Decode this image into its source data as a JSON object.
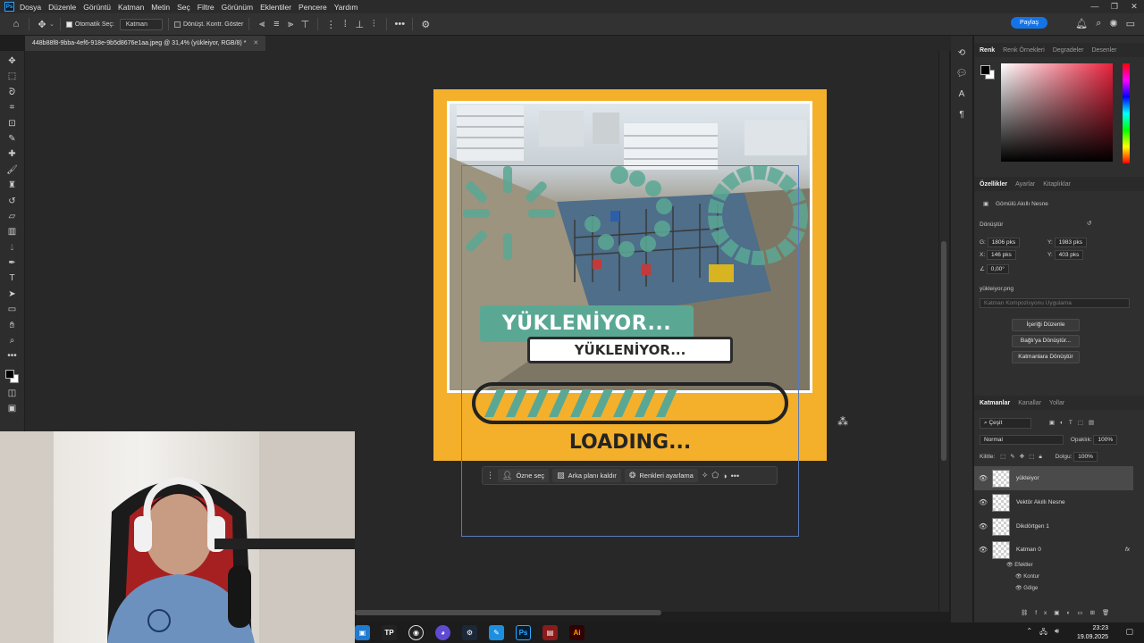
{
  "menu": {
    "logo": "Ps",
    "items": [
      "Dosya",
      "Düzenle",
      "Görüntü",
      "Katman",
      "Metin",
      "Seç",
      "Filtre",
      "Görünüm",
      "Eklentiler",
      "Pencere",
      "Yardım"
    ]
  },
  "options_bar": {
    "auto_select_label": "Otomatik Seç:",
    "auto_select_value": "Katman",
    "transform_controls_label": "Dönüşt. Kontr. Göster",
    "share_label": "Paylaş"
  },
  "document": {
    "tab_title": "448b88f8-9bba-4ef6-918e-9b5d8676e1aa.jpeg @ 31,4% (yükleiyor, RGB/8) *"
  },
  "artwork": {
    "pill_text": "YÜKLENİYOR...",
    "box_text": "YÜKLENİYOR...",
    "loading_text": "LOADING...",
    "accent_color": "#f4b02b",
    "teal_color": "#5aa894"
  },
  "context_bar": {
    "select_subject": "Özne seç",
    "remove_background": "Arka planı kaldır",
    "color_adjust": "Renkleri ayarlama"
  },
  "color_panel": {
    "tabs": [
      "Renk",
      "Renk Örnekleri",
      "Degradeler",
      "Desenler"
    ]
  },
  "properties_panel": {
    "tabs": [
      "Özellikler",
      "Ayarlar",
      "Kitaplıklar"
    ],
    "object_type": "Gömülü Akıllı Nesne",
    "section_transform": "Dönüştür",
    "w_label": "G:",
    "w_value": "1806 pks",
    "h_label": "Y:",
    "h_value": "1983 pks",
    "x_label": "X:",
    "x_value": "146 pks",
    "y_label": "Y:",
    "y_value": "403 pks",
    "angle_value": "0,00°",
    "source_file": "yükleiyor.png",
    "comp_placeholder": "Katman Kompozisyonu Uygulama",
    "btn_edit": "İçeriği Düzenle",
    "btn_convert_linked": "Bağlı'ya Dönüştür...",
    "btn_convert_layers": "Katmanlara Dönüştür"
  },
  "layers_panel": {
    "tabs": [
      "Katmanlar",
      "Kanallar",
      "Yollar"
    ],
    "filter_label": "Çeşit",
    "blend_mode": "Normal",
    "opacity_label": "Opaklık:",
    "opacity_value": "100%",
    "lock_label": "Kilitle:",
    "fill_label": "Dolgu:",
    "fill_value": "100%",
    "layers": [
      "yükleiyor",
      "Vektör Akıllı Nesne",
      "Dikdörtgen 1",
      "Katman 0"
    ],
    "effects_label": "Efektler",
    "effect_1": "Kontur",
    "effect_2": "Gölge"
  },
  "taskbar": {
    "time": "23:23",
    "date": "19.09.2025",
    "tp_label": "TP",
    "ps_label": "Ps",
    "ai_label": "Ai"
  }
}
